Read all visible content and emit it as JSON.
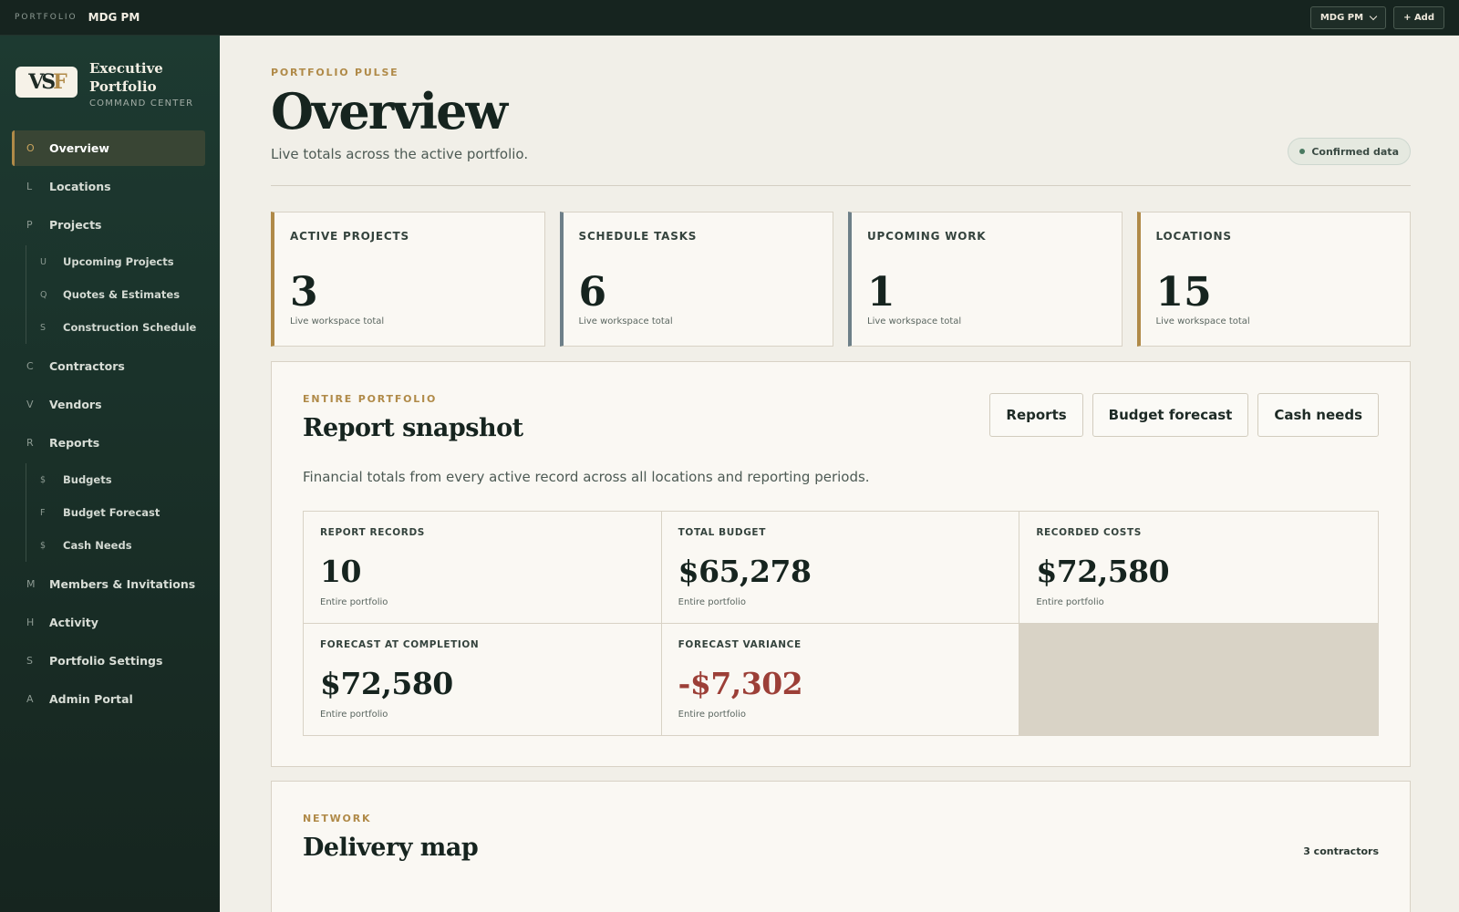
{
  "topbar": {
    "kicker": "PORTFOLIO",
    "workspace": "MDG PM",
    "switcher_label": "MDG PM",
    "add_label": "+ Add"
  },
  "brand": {
    "logo_text_a": "VS",
    "logo_text_b": "F",
    "title_line1": "Executive",
    "title_line2": "Portfolio",
    "subtitle": "COMMAND CENTER"
  },
  "sidebar": {
    "overview": {
      "letter": "O",
      "label": "Overview"
    },
    "locations": {
      "letter": "L",
      "label": "Locations"
    },
    "projects": {
      "letter": "P",
      "label": "Projects"
    },
    "upcoming_projects": {
      "letter": "U",
      "label": "Upcoming Projects"
    },
    "quotes": {
      "letter": "Q",
      "label": "Quotes & Estimates"
    },
    "construction_schedule": {
      "letter": "S",
      "label": "Construction Schedule"
    },
    "contractors": {
      "letter": "C",
      "label": "Contractors"
    },
    "vendors": {
      "letter": "V",
      "label": "Vendors"
    },
    "reports": {
      "letter": "R",
      "label": "Reports"
    },
    "budgets": {
      "letter": "$",
      "label": "Budgets"
    },
    "budget_forecast": {
      "letter": "F",
      "label": "Budget Forecast"
    },
    "cash_needs": {
      "letter": "$",
      "label": "Cash Needs"
    },
    "members": {
      "letter": "M",
      "label": "Members & Invitations"
    },
    "activity": {
      "letter": "H",
      "label": "Activity"
    },
    "settings": {
      "letter": "S",
      "label": "Portfolio Settings"
    },
    "admin": {
      "letter": "A",
      "label": "Admin Portal"
    }
  },
  "header": {
    "kicker": "PORTFOLIO PULSE",
    "title": "Overview",
    "description": "Live totals across the active portfolio.",
    "badge": "Confirmed data"
  },
  "stats": [
    {
      "label": "ACTIVE PROJECTS",
      "value": "3",
      "caption": "Live workspace total"
    },
    {
      "label": "SCHEDULE TASKS",
      "value": "6",
      "caption": "Live workspace total"
    },
    {
      "label": "UPCOMING WORK",
      "value": "1",
      "caption": "Live workspace total"
    },
    {
      "label": "LOCATIONS",
      "value": "15",
      "caption": "Live workspace total"
    }
  ],
  "snapshot": {
    "kicker": "ENTIRE PORTFOLIO",
    "title": "Report snapshot",
    "description": "Financial totals from every active record across all locations and reporting periods.",
    "buttons": {
      "reports": "Reports",
      "budget_forecast": "Budget forecast",
      "cash_needs": "Cash needs"
    },
    "cells": [
      {
        "label": "REPORT RECORDS",
        "value": "10",
        "caption": "Entire portfolio"
      },
      {
        "label": "TOTAL BUDGET",
        "value": "$65,278",
        "caption": "Entire portfolio"
      },
      {
        "label": "RECORDED COSTS",
        "value": "$72,580",
        "caption": "Entire portfolio"
      },
      {
        "label": "FORECAST AT COMPLETION",
        "value": "$72,580",
        "caption": "Entire portfolio"
      },
      {
        "label": "FORECAST VARIANCE",
        "value": "-$7,302",
        "caption": "Entire portfolio"
      }
    ]
  },
  "network": {
    "kicker": "NETWORK",
    "title": "Delivery map",
    "count": "3 contractors"
  },
  "colors": {
    "accent_gold": "#b08a48",
    "sidebar_dark": "#16251f",
    "negative": "#9c3f37"
  }
}
